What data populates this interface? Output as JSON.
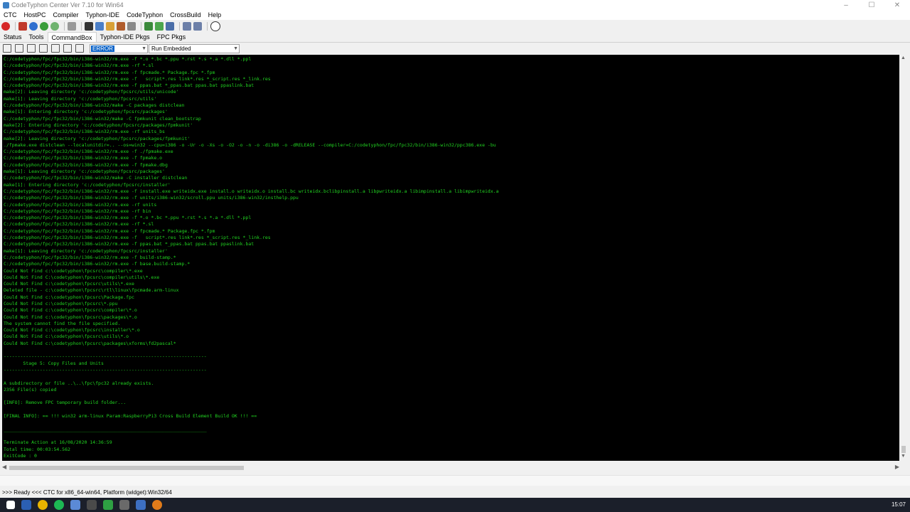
{
  "window": {
    "title": "CodeTyphon Center Ver 7.10 for Win64"
  },
  "menu": [
    "CTC",
    "HostPC",
    "Compiler",
    "Typhon-IDE",
    "CodeTyphon",
    "CrossBuild",
    "Help"
  ],
  "tabs": [
    "Status",
    "Tools",
    "CommandBox",
    "Typhon-IDE Pkgs",
    "FPC Pkgs"
  ],
  "active_tab": "CommandBox",
  "toolbar2": {
    "filter_value": "ERROR",
    "mode_value": "Run Embedded"
  },
  "console_text": "C:/codetyphon/fpc/fpc32/bin/i386-win32/rm.exe -f *.o *.bc *.ppu *.rst *.s *.a *.dll *.ppl\nC:/codetyphon/fpc/fpc32/bin/i386-win32/rm.exe -rf *.sl\nC:/codetyphon/fpc/fpc32/bin/i386-win32/rm.exe -f fpcmade.* Package.fpc *.fpm\nC:/codetyphon/fpc/fpc32/bin/i386-win32/rm.exe -f   script*.res link*.res *_script.res *_link.res\nC:/codetyphon/fpc/fpc32/bin/i386-win32/rm.exe -f ppas.bat *_ppas.bat ppas.bat ppaslink.bat\nmake[2]: Leaving directory 'c:/codetyphon/fpcsrc/utils/unicode'\nmake[1]: Leaving directory 'c:/codetyphon/fpcsrc/utils'\nC:/codetyphon/fpc/fpc32/bin/i386-win32/make -C packages distclean\nmake[1]: Entering directory 'c:/codetyphon/fpcsrc/packages'\nC:/codetyphon/fpc/fpc32/bin/i386-win32/make -C fpmkunit clean_bootstrap\nmake[2]: Entering directory 'c:/codetyphon/fpcsrc/packages/fpmkunit'\nC:/codetyphon/fpc/fpc32/bin/i386-win32/rm.exe -rf units_bs\nmake[2]: Leaving directory 'c:/codetyphon/fpcsrc/packages/fpmkunit'\n./fpmake.exe distclean --localunitdir=.. --os=win32 --cpu=i386 -o -Ur -o -Xs -o -O2 -o -n -o -di386 -o -dRELEASE --compiler=C:/codetyphon/fpc/fpc32/bin/i386-win32/ppc386.exe -bu\nC:/codetyphon/fpc/fpc32/bin/i386-win32/rm.exe -f ./fpmake.exe\nC:/codetyphon/fpc/fpc32/bin/i386-win32/rm.exe -f fpmake.o\nC:/codetyphon/fpc/fpc32/bin/i386-win32/rm.exe -f fpmake.dbg\nmake[1]: Leaving directory 'c:/codetyphon/fpcsrc/packages'\nC:/codetyphon/fpc/fpc32/bin/i386-win32/make -C installer distclean\nmake[1]: Entering directory 'c:/codetyphon/fpcsrc/installer'\nC:/codetyphon/fpc/fpc32/bin/i386-win32/rm.exe -f install.exe writeidx.exe install.o writeidx.o install.bc writeidx.bclibpinstall.a libpwriteidx.a libimpinstall.a libimpwriteidx.a\nC:/codetyphon/fpc/fpc32/bin/i386-win32/rm.exe -f units/i386-win32/scroll.ppu units/i386-win32/insthelp.ppu\nC:/codetyphon/fpc/fpc32/bin/i386-win32/rm.exe -rf units\nC:/codetyphon/fpc/fpc32/bin/i386-win32/rm.exe -rf bin\nC:/codetyphon/fpc/fpc32/bin/i386-win32/rm.exe -f *.o *.bc *.ppu *.rst *.s *.a *.dll *.ppl\nC:/codetyphon/fpc/fpc32/bin/i386-win32/rm.exe -rf *.sl\nC:/codetyphon/fpc/fpc32/bin/i386-win32/rm.exe -f fpcmade.* Package.fpc *.fpm\nC:/codetyphon/fpc/fpc32/bin/i386-win32/rm.exe -f   script*.res link*.res *_script.res *_link.res\nC:/codetyphon/fpc/fpc32/bin/i386-win32/rm.exe -f ppas.bat *_ppas.bat ppas.bat ppaslink.bat\nmake[1]: Leaving directory 'c:/codetyphon/fpcsrc/installer'\nC:/codetyphon/fpc/fpc32/bin/i386-win32/rm.exe -f build-stamp.*\nC:/codetyphon/fpc/fpc32/bin/i386-win32/rm.exe -f base.build-stamp.*\nCould Not Find c:\\codetyphon\\fpcsrc\\compiler\\*.exe\nCould Not Find C:\\codetyphon\\fpcsrc\\compiler\\utils\\*.exe\nCould Not Find c:\\codetyphon\\fpcsrc\\utils\\*.exe\nDeleted file - c:\\codetyphon\\fpcsrc\\rtl\\linux\\fpcmade.arm-linux\nCould Not Find c:\\codetyphon\\fpcsrc\\Package.fpc\nCould Not Find c:\\codetyphon\\fpcsrc\\*.ppu\nCould Not Find c:\\codetyphon\\fpcsrc\\compiler\\*.o\nCould Not Find c:\\codetyphon\\fpcsrc\\packages\\*.o\nThe system cannot find the file specified.\nCould Not Find c:\\codetyphon\\fpcsrc\\installer\\*.o\nCould Not Find c:\\codetyphon\\fpcsrc\\utils\\*.o\nCould Not Find c:\\codetyphon\\fpcsrc\\packages\\xforms\\fd2pascal*\n\n-------------------------------------------------------------------------\n       Stage 5: Copy Files and Units\n-------------------------------------------------------------------------\n\nA subdirectory or file ..\\..\\fpc\\fpc32 already exists.\n2356 File(s) copied\n\n[INFO]: Remove FPC temporary build folder...\n\n[FINAL INFO]: == !!! win32 arm-linux Param:RaspberryPi3 Cross Build Element Build OK !!! ==\n\n_________________________________________________________________________\n\nTerminate Action at 16/08/2020 14:36:59\nTotal time: 00:03:54.562\nExitCode : 0",
  "status_text": ">>> Ready <<<  CTC for x86_64-win64, Platform (widget):Win32/64",
  "clock": "15:07",
  "colors": {
    "console_bg": "#000000",
    "console_fg": "#21d321",
    "accent": "#0a63c8"
  }
}
